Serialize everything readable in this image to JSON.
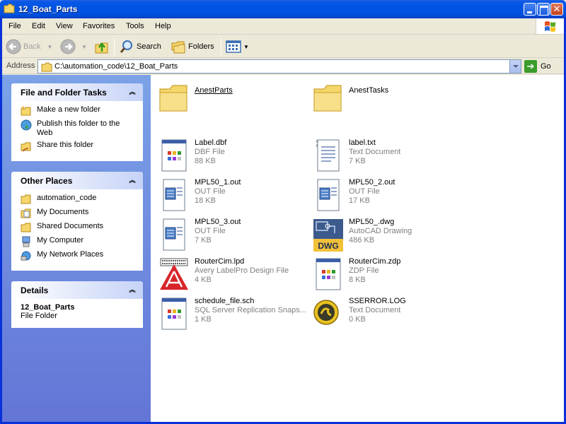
{
  "window": {
    "title": "12_Boat_Parts"
  },
  "menu": {
    "items": [
      "File",
      "Edit",
      "View",
      "Favorites",
      "Tools",
      "Help"
    ]
  },
  "toolbar": {
    "back_label": "Back",
    "search_label": "Search",
    "folders_label": "Folders"
  },
  "address": {
    "label": "Address",
    "value": "C:\\automation_code\\12_Boat_Parts",
    "go_label": "Go"
  },
  "left_pane": {
    "file_tasks": {
      "title": "File and Folder Tasks",
      "items": [
        {
          "label": "Make a new folder",
          "icon": "new-folder-icon"
        },
        {
          "label": "Publish this folder to the Web",
          "icon": "globe-icon"
        },
        {
          "label": "Share this folder",
          "icon": "share-folder-icon"
        }
      ]
    },
    "other_places": {
      "title": "Other Places",
      "items": [
        {
          "label": "automation_code",
          "icon": "folder-icon"
        },
        {
          "label": "My Documents",
          "icon": "my-documents-icon"
        },
        {
          "label": "Shared Documents",
          "icon": "folder-icon"
        },
        {
          "label": "My Computer",
          "icon": "my-computer-icon"
        },
        {
          "label": "My Network Places",
          "icon": "network-places-icon"
        }
      ]
    },
    "details": {
      "title": "Details",
      "name": "12_Boat_Parts",
      "type": "File Folder"
    }
  },
  "files": [
    {
      "name": "AnestParts",
      "type": "",
      "size": "",
      "icon": "folder-icon"
    },
    {
      "name": "AnestTasks",
      "type": "",
      "size": "",
      "icon": "folder-icon"
    },
    {
      "name": "Label.dbf",
      "type": "DBF File",
      "size": "88 KB",
      "icon": "generic-file-icon"
    },
    {
      "name": "label.txt",
      "type": "Text Document",
      "size": "7 KB",
      "icon": "text-document-icon"
    },
    {
      "name": "MPL50_1.out",
      "type": "OUT File",
      "size": "18 KB",
      "icon": "out-file-icon"
    },
    {
      "name": "MPL50_2.out",
      "type": "OUT File",
      "size": "17 KB",
      "icon": "out-file-icon"
    },
    {
      "name": "MPL50_3.out",
      "type": "OUT File",
      "size": "7 KB",
      "icon": "out-file-icon"
    },
    {
      "name": "MPL50_.dwg",
      "type": "AutoCAD Drawing",
      "size": "486 KB",
      "icon": "dwg-icon"
    },
    {
      "name": "RouterCim.lpd",
      "type": "Avery LabelPro Design File",
      "size": "4 KB",
      "icon": "avery-icon"
    },
    {
      "name": "RouterCim.zdp",
      "type": "ZDP File",
      "size": "8 KB",
      "icon": "generic-file-icon"
    },
    {
      "name": "schedule_file.sch",
      "type": "SQL Server Replication Snaps...",
      "size": "1 KB",
      "icon": "generic-file-icon"
    },
    {
      "name": "SSERROR.LOG",
      "type": "Text Document",
      "size": "0 KB",
      "icon": "log-icon"
    }
  ],
  "colors": {
    "title_blue": "#0054e3",
    "pane_blue": "#7ba2e7",
    "panel_bg": "#ffffff",
    "folder_yellow": "#f5d66a"
  }
}
